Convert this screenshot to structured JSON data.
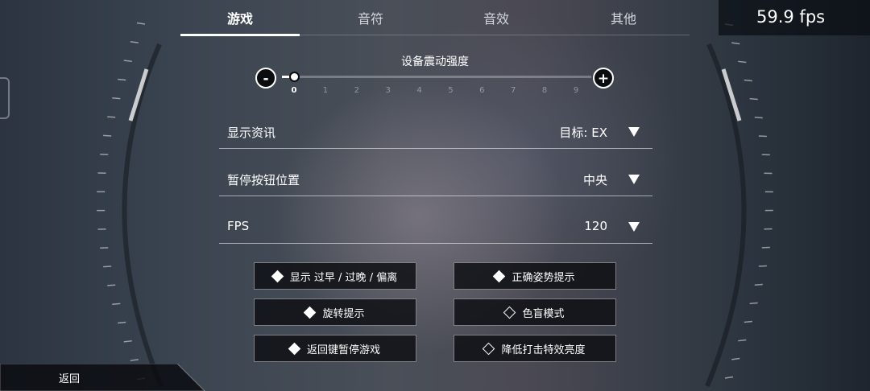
{
  "tabs": [
    {
      "label": "游戏",
      "active": true
    },
    {
      "label": "音符",
      "active": false
    },
    {
      "label": "音效",
      "active": false
    },
    {
      "label": "其他",
      "active": false
    }
  ],
  "fps_counter": "59.9 fps",
  "vibration": {
    "title": "设备震动强度",
    "minus_label": "-",
    "plus_label": "+",
    "value": 0,
    "min": 0,
    "max": 9,
    "ticks": [
      "0",
      "1",
      "2",
      "3",
      "4",
      "5",
      "6",
      "7",
      "8",
      "9"
    ]
  },
  "settings": [
    {
      "label": "显示资讯",
      "value": "目标: EX"
    },
    {
      "label": "暂停按钮位置",
      "value": "中央"
    },
    {
      "label": "FPS",
      "value": "120"
    }
  ],
  "options": [
    {
      "label": "显示 过早 / 过晚 / 偏离",
      "checked": true
    },
    {
      "label": "正确姿势提示",
      "checked": true
    },
    {
      "label": "旋转提示",
      "checked": true
    },
    {
      "label": "色盲模式",
      "checked": false
    },
    {
      "label": "返回键暂停游戏",
      "checked": true
    },
    {
      "label": "降低打击特效亮度",
      "checked": false
    }
  ],
  "back_label": "返回",
  "colors": {
    "accent": "#ffffff",
    "panel": "#0c0e12"
  }
}
